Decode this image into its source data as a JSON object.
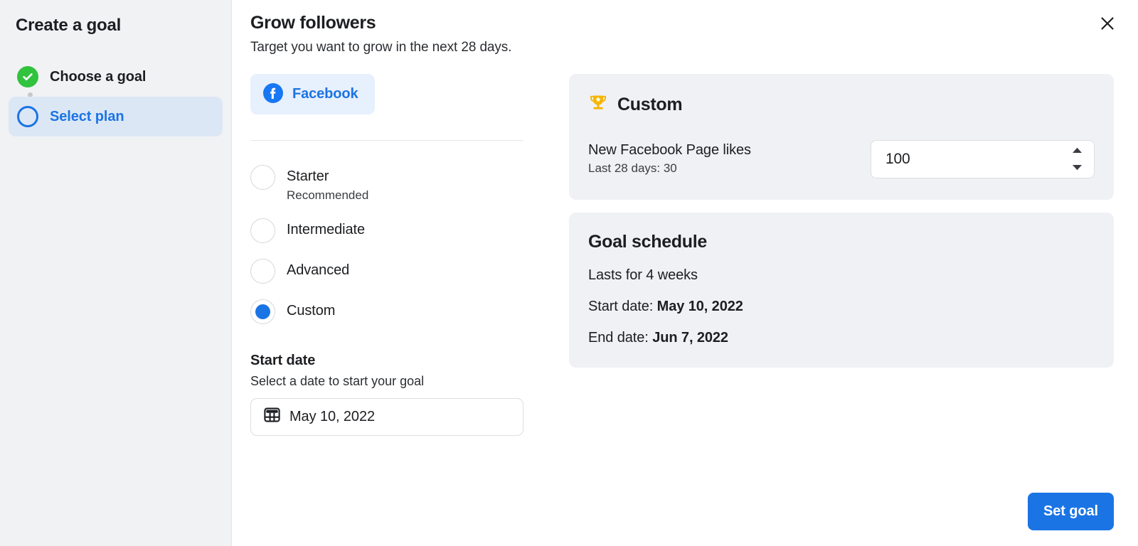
{
  "sidebar": {
    "title": "Create a goal",
    "steps": [
      {
        "label": "Choose a goal",
        "state": "completed",
        "icon": "check-circle-icon"
      },
      {
        "label": "Select plan",
        "state": "active",
        "icon": "ring-circle-icon"
      }
    ]
  },
  "main": {
    "title": "Grow followers",
    "subtitle": "Target you want to grow in the next 28 days.",
    "close_icon": "close-icon",
    "network": {
      "label": "Facebook",
      "icon": "facebook-icon"
    },
    "plans": {
      "options": [
        {
          "label": "Starter",
          "note": "Recommended",
          "selected": false
        },
        {
          "label": "Intermediate",
          "note": "",
          "selected": false
        },
        {
          "label": "Advanced",
          "note": "",
          "selected": false
        },
        {
          "label": "Custom",
          "note": "",
          "selected": true
        }
      ]
    },
    "start_date": {
      "title": "Start date",
      "subtitle": "Select a date to start your goal",
      "icon": "calendar-icon",
      "value": "May 10, 2022"
    },
    "custom_card": {
      "icon": "trophy-icon",
      "title": "Custom",
      "metric_label": "New Facebook Page likes",
      "metric_sub": "Last 28 days: 30",
      "value": "100",
      "increment_icon": "caret-up-icon",
      "decrement_icon": "caret-down-icon"
    },
    "schedule_card": {
      "title": "Goal schedule",
      "duration": "Lasts for 4 weeks",
      "start_label": "Start date:",
      "start_value": "May 10, 2022",
      "end_label": "End date:",
      "end_value": "Jun 7, 2022"
    },
    "footer": {
      "submit_label": "Set goal"
    }
  },
  "colors": {
    "accent_blue": "#1b74e4",
    "pill_bg": "#e7f0fd",
    "success_green": "#31c23e",
    "card_bg": "#eff1f4",
    "sidebar_bg": "#f1f2f3",
    "active_step_bg": "#dce7f6",
    "trophy_gold": "#f7b500"
  }
}
